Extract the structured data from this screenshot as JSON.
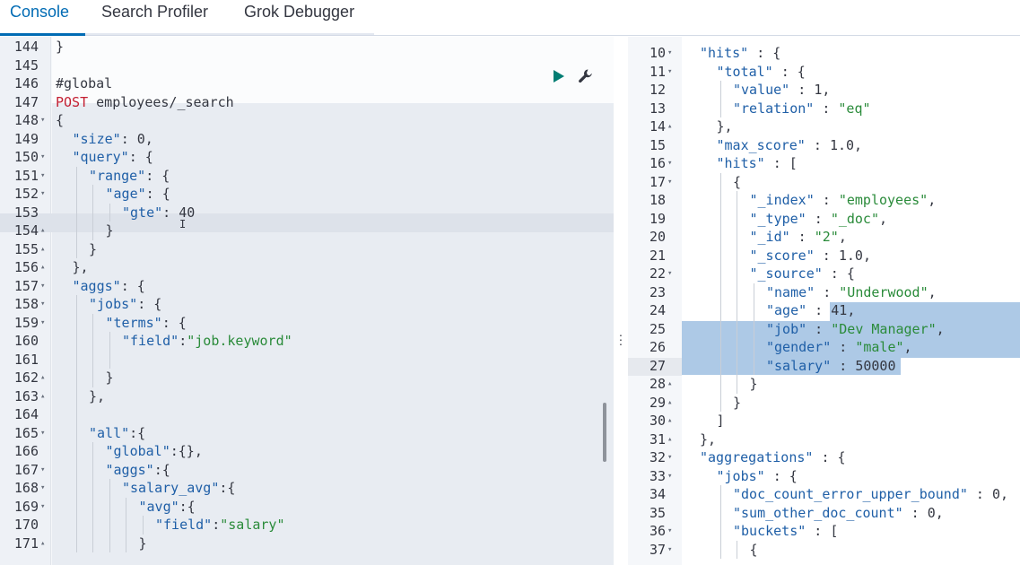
{
  "tabs": [
    {
      "label": "Console",
      "active": true
    },
    {
      "label": "Search Profiler",
      "active": false
    },
    {
      "label": "Grok Debugger",
      "active": false
    }
  ],
  "editor": {
    "lines": [
      {
        "n": "144",
        "f": "",
        "d": 0,
        "t": [
          [
            "c",
            "}"
          ]
        ]
      },
      {
        "n": "145",
        "f": "",
        "d": 0,
        "t": []
      },
      {
        "n": "146",
        "f": "",
        "d": 0,
        "t": [
          [
            "c",
            "#global"
          ]
        ]
      },
      {
        "n": "147",
        "f": "",
        "d": 0,
        "t": [
          [
            "m",
            "POST "
          ],
          [
            "c",
            "employees/_search"
          ]
        ]
      },
      {
        "n": "148",
        "f": "▾",
        "d": 0,
        "t": [
          [
            "c",
            "{"
          ]
        ]
      },
      {
        "n": "149",
        "f": "",
        "d": 1,
        "t": [
          [
            "k",
            "\"size\""
          ],
          [
            "c",
            ": "
          ],
          [
            "n",
            "0"
          ],
          [
            "c",
            ","
          ]
        ]
      },
      {
        "n": "150",
        "f": "▾",
        "d": 1,
        "t": [
          [
            "k",
            "\"query\""
          ],
          [
            "c",
            ": {"
          ]
        ]
      },
      {
        "n": "151",
        "f": "▾",
        "d": 2,
        "t": [
          [
            "k",
            "\"range\""
          ],
          [
            "c",
            ": {"
          ]
        ]
      },
      {
        "n": "152",
        "f": "▾",
        "d": 3,
        "t": [
          [
            "k",
            "\"age\""
          ],
          [
            "c",
            ": {"
          ]
        ]
      },
      {
        "n": "153",
        "f": "",
        "d": 4,
        "t": [
          [
            "k",
            "\"gte\""
          ],
          [
            "c",
            ": "
          ],
          [
            "n",
            "40"
          ]
        ]
      },
      {
        "n": "154",
        "f": "▴",
        "d": 3,
        "t": [
          [
            "c",
            "}"
          ]
        ]
      },
      {
        "n": "155",
        "f": "▴",
        "d": 2,
        "t": [
          [
            "c",
            "}"
          ]
        ]
      },
      {
        "n": "156",
        "f": "▴",
        "d": 1,
        "t": [
          [
            "c",
            "},"
          ]
        ]
      },
      {
        "n": "157",
        "f": "▾",
        "d": 1,
        "t": [
          [
            "k",
            "\"aggs\""
          ],
          [
            "c",
            ": {"
          ]
        ]
      },
      {
        "n": "158",
        "f": "▾",
        "d": 2,
        "t": [
          [
            "k",
            "\"jobs\""
          ],
          [
            "c",
            ": {"
          ]
        ]
      },
      {
        "n": "159",
        "f": "▾",
        "d": 3,
        "t": [
          [
            "k",
            "\"terms\""
          ],
          [
            "c",
            ": {"
          ]
        ]
      },
      {
        "n": "160",
        "f": "",
        "d": 4,
        "t": [
          [
            "k",
            "\"field\""
          ],
          [
            "c",
            ":"
          ],
          [
            "s",
            "\"job.keyword\""
          ]
        ]
      },
      {
        "n": "161",
        "f": "",
        "d": 4,
        "t": []
      },
      {
        "n": "162",
        "f": "▴",
        "d": 3,
        "t": [
          [
            "c",
            "}"
          ]
        ]
      },
      {
        "n": "163",
        "f": "▴",
        "d": 2,
        "t": [
          [
            "c",
            "},"
          ]
        ]
      },
      {
        "n": "164",
        "f": "",
        "d": 2,
        "t": []
      },
      {
        "n": "165",
        "f": "▾",
        "d": 2,
        "t": [
          [
            "k",
            "\"all\""
          ],
          [
            "c",
            ":{"
          ]
        ]
      },
      {
        "n": "166",
        "f": "",
        "d": 3,
        "t": [
          [
            "k",
            "\"global\""
          ],
          [
            "c",
            ":{},"
          ]
        ]
      },
      {
        "n": "167",
        "f": "▾",
        "d": 3,
        "t": [
          [
            "k",
            "\"aggs\""
          ],
          [
            "c",
            ":{"
          ]
        ]
      },
      {
        "n": "168",
        "f": "▾",
        "d": 4,
        "t": [
          [
            "k",
            "\"salary_avg\""
          ],
          [
            "c",
            ":{"
          ]
        ]
      },
      {
        "n": "169",
        "f": "▾",
        "d": 5,
        "t": [
          [
            "k",
            "\"avg\""
          ],
          [
            "c",
            ":{"
          ]
        ]
      },
      {
        "n": "170",
        "f": "",
        "d": 6,
        "t": [
          [
            "k",
            "\"field\""
          ],
          [
            "c",
            ":"
          ],
          [
            "s",
            "\"salary\""
          ]
        ]
      },
      {
        "n": "171",
        "f": "▴",
        "d": 5,
        "t": [
          [
            "c",
            "}"
          ]
        ]
      }
    ]
  },
  "output": {
    "lines": [
      {
        "n": "10",
        "f": "▾",
        "d": 0,
        "t": [
          [
            "k",
            "\"hits\""
          ],
          [
            "c",
            " : {"
          ]
        ]
      },
      {
        "n": "11",
        "f": "▾",
        "d": 1,
        "t": [
          [
            "k",
            "\"total\""
          ],
          [
            "c",
            " : {"
          ]
        ]
      },
      {
        "n": "12",
        "f": "",
        "d": 2,
        "t": [
          [
            "k",
            "\"value\""
          ],
          [
            "c",
            " : "
          ],
          [
            "n",
            "1"
          ],
          [
            "c",
            ","
          ]
        ]
      },
      {
        "n": "13",
        "f": "",
        "d": 2,
        "t": [
          [
            "k",
            "\"relation\""
          ],
          [
            "c",
            " : "
          ],
          [
            "s",
            "\"eq\""
          ]
        ]
      },
      {
        "n": "14",
        "f": "▴",
        "d": 1,
        "t": [
          [
            "c",
            "},"
          ]
        ]
      },
      {
        "n": "15",
        "f": "",
        "d": 1,
        "t": [
          [
            "k",
            "\"max_score\""
          ],
          [
            "c",
            " : "
          ],
          [
            "n",
            "1.0"
          ],
          [
            "c",
            ","
          ]
        ]
      },
      {
        "n": "16",
        "f": "▾",
        "d": 1,
        "t": [
          [
            "k",
            "\"hits\""
          ],
          [
            "c",
            " : ["
          ]
        ]
      },
      {
        "n": "17",
        "f": "▾",
        "d": 2,
        "t": [
          [
            "c",
            "{"
          ]
        ]
      },
      {
        "n": "18",
        "f": "",
        "d": 3,
        "t": [
          [
            "k",
            "\"_index\""
          ],
          [
            "c",
            " : "
          ],
          [
            "s",
            "\"employees\""
          ],
          [
            "c",
            ","
          ]
        ]
      },
      {
        "n": "19",
        "f": "",
        "d": 3,
        "t": [
          [
            "k",
            "\"_type\""
          ],
          [
            "c",
            " : "
          ],
          [
            "s",
            "\"_doc\""
          ],
          [
            "c",
            ","
          ]
        ]
      },
      {
        "n": "20",
        "f": "",
        "d": 3,
        "t": [
          [
            "k",
            "\"_id\""
          ],
          [
            "c",
            " : "
          ],
          [
            "s",
            "\"2\""
          ],
          [
            "c",
            ","
          ]
        ]
      },
      {
        "n": "21",
        "f": "",
        "d": 3,
        "t": [
          [
            "k",
            "\"_score\""
          ],
          [
            "c",
            " : "
          ],
          [
            "n",
            "1.0"
          ],
          [
            "c",
            ","
          ]
        ]
      },
      {
        "n": "22",
        "f": "▾",
        "d": 3,
        "t": [
          [
            "k",
            "\"_source\""
          ],
          [
            "c",
            " : {"
          ]
        ]
      },
      {
        "n": "23",
        "f": "",
        "d": 4,
        "t": [
          [
            "k",
            "\"name\""
          ],
          [
            "c",
            " : "
          ],
          [
            "s",
            "\"Underwood\""
          ],
          [
            "c",
            ","
          ]
        ]
      },
      {
        "n": "24",
        "f": "",
        "d": 4,
        "t": [
          [
            "k",
            "\"age\""
          ],
          [
            "c",
            " : "
          ],
          [
            "n",
            "41"
          ],
          [
            "c",
            ","
          ]
        ]
      },
      {
        "n": "25",
        "f": "",
        "d": 4,
        "t": [
          [
            "k",
            "\"job\""
          ],
          [
            "c",
            " : "
          ],
          [
            "s",
            "\"Dev Manager\""
          ],
          [
            "c",
            ","
          ]
        ]
      },
      {
        "n": "26",
        "f": "",
        "d": 4,
        "t": [
          [
            "k",
            "\"gender\""
          ],
          [
            "c",
            " : "
          ],
          [
            "s",
            "\"male\""
          ],
          [
            "c",
            ","
          ]
        ]
      },
      {
        "n": "27",
        "f": "",
        "d": 4,
        "t": [
          [
            "k",
            "\"salary\""
          ],
          [
            "c",
            " : "
          ],
          [
            "n",
            "50000"
          ]
        ]
      },
      {
        "n": "28",
        "f": "▴",
        "d": 3,
        "t": [
          [
            "c",
            "}"
          ]
        ]
      },
      {
        "n": "29",
        "f": "▴",
        "d": 2,
        "t": [
          [
            "c",
            "}"
          ]
        ]
      },
      {
        "n": "30",
        "f": "▴",
        "d": 1,
        "t": [
          [
            "c",
            "]"
          ]
        ]
      },
      {
        "n": "31",
        "f": "▴",
        "d": 0,
        "t": [
          [
            "c",
            "},"
          ]
        ]
      },
      {
        "n": "32",
        "f": "▾",
        "d": 0,
        "t": [
          [
            "k",
            "\"aggregations\""
          ],
          [
            "c",
            " : {"
          ]
        ]
      },
      {
        "n": "33",
        "f": "▾",
        "d": 1,
        "t": [
          [
            "k",
            "\"jobs\""
          ],
          [
            "c",
            " : {"
          ]
        ]
      },
      {
        "n": "34",
        "f": "",
        "d": 2,
        "t": [
          [
            "k",
            "\"doc_count_error_upper_bound\""
          ],
          [
            "c",
            " : "
          ],
          [
            "n",
            "0"
          ],
          [
            "c",
            ","
          ]
        ]
      },
      {
        "n": "35",
        "f": "",
        "d": 2,
        "t": [
          [
            "k",
            "\"sum_other_doc_count\""
          ],
          [
            "c",
            " : "
          ],
          [
            "n",
            "0"
          ],
          [
            "c",
            ","
          ]
        ]
      },
      {
        "n": "36",
        "f": "▾",
        "d": 2,
        "t": [
          [
            "k",
            "\"buckets\""
          ],
          [
            "c",
            " : ["
          ]
        ]
      },
      {
        "n": "37",
        "f": "▾",
        "d": 3,
        "t": [
          [
            "c",
            "{"
          ]
        ]
      }
    ]
  },
  "icons": {
    "run": "play-icon",
    "settings": "wrench-icon",
    "resize": "vertical-dots-icon"
  },
  "colors": {
    "accent": "#006bb4",
    "run": "#017d73",
    "method": "#c31f32",
    "key": "#1f5fa7",
    "string": "#2a8b3a",
    "selection": "#adc9e6"
  }
}
